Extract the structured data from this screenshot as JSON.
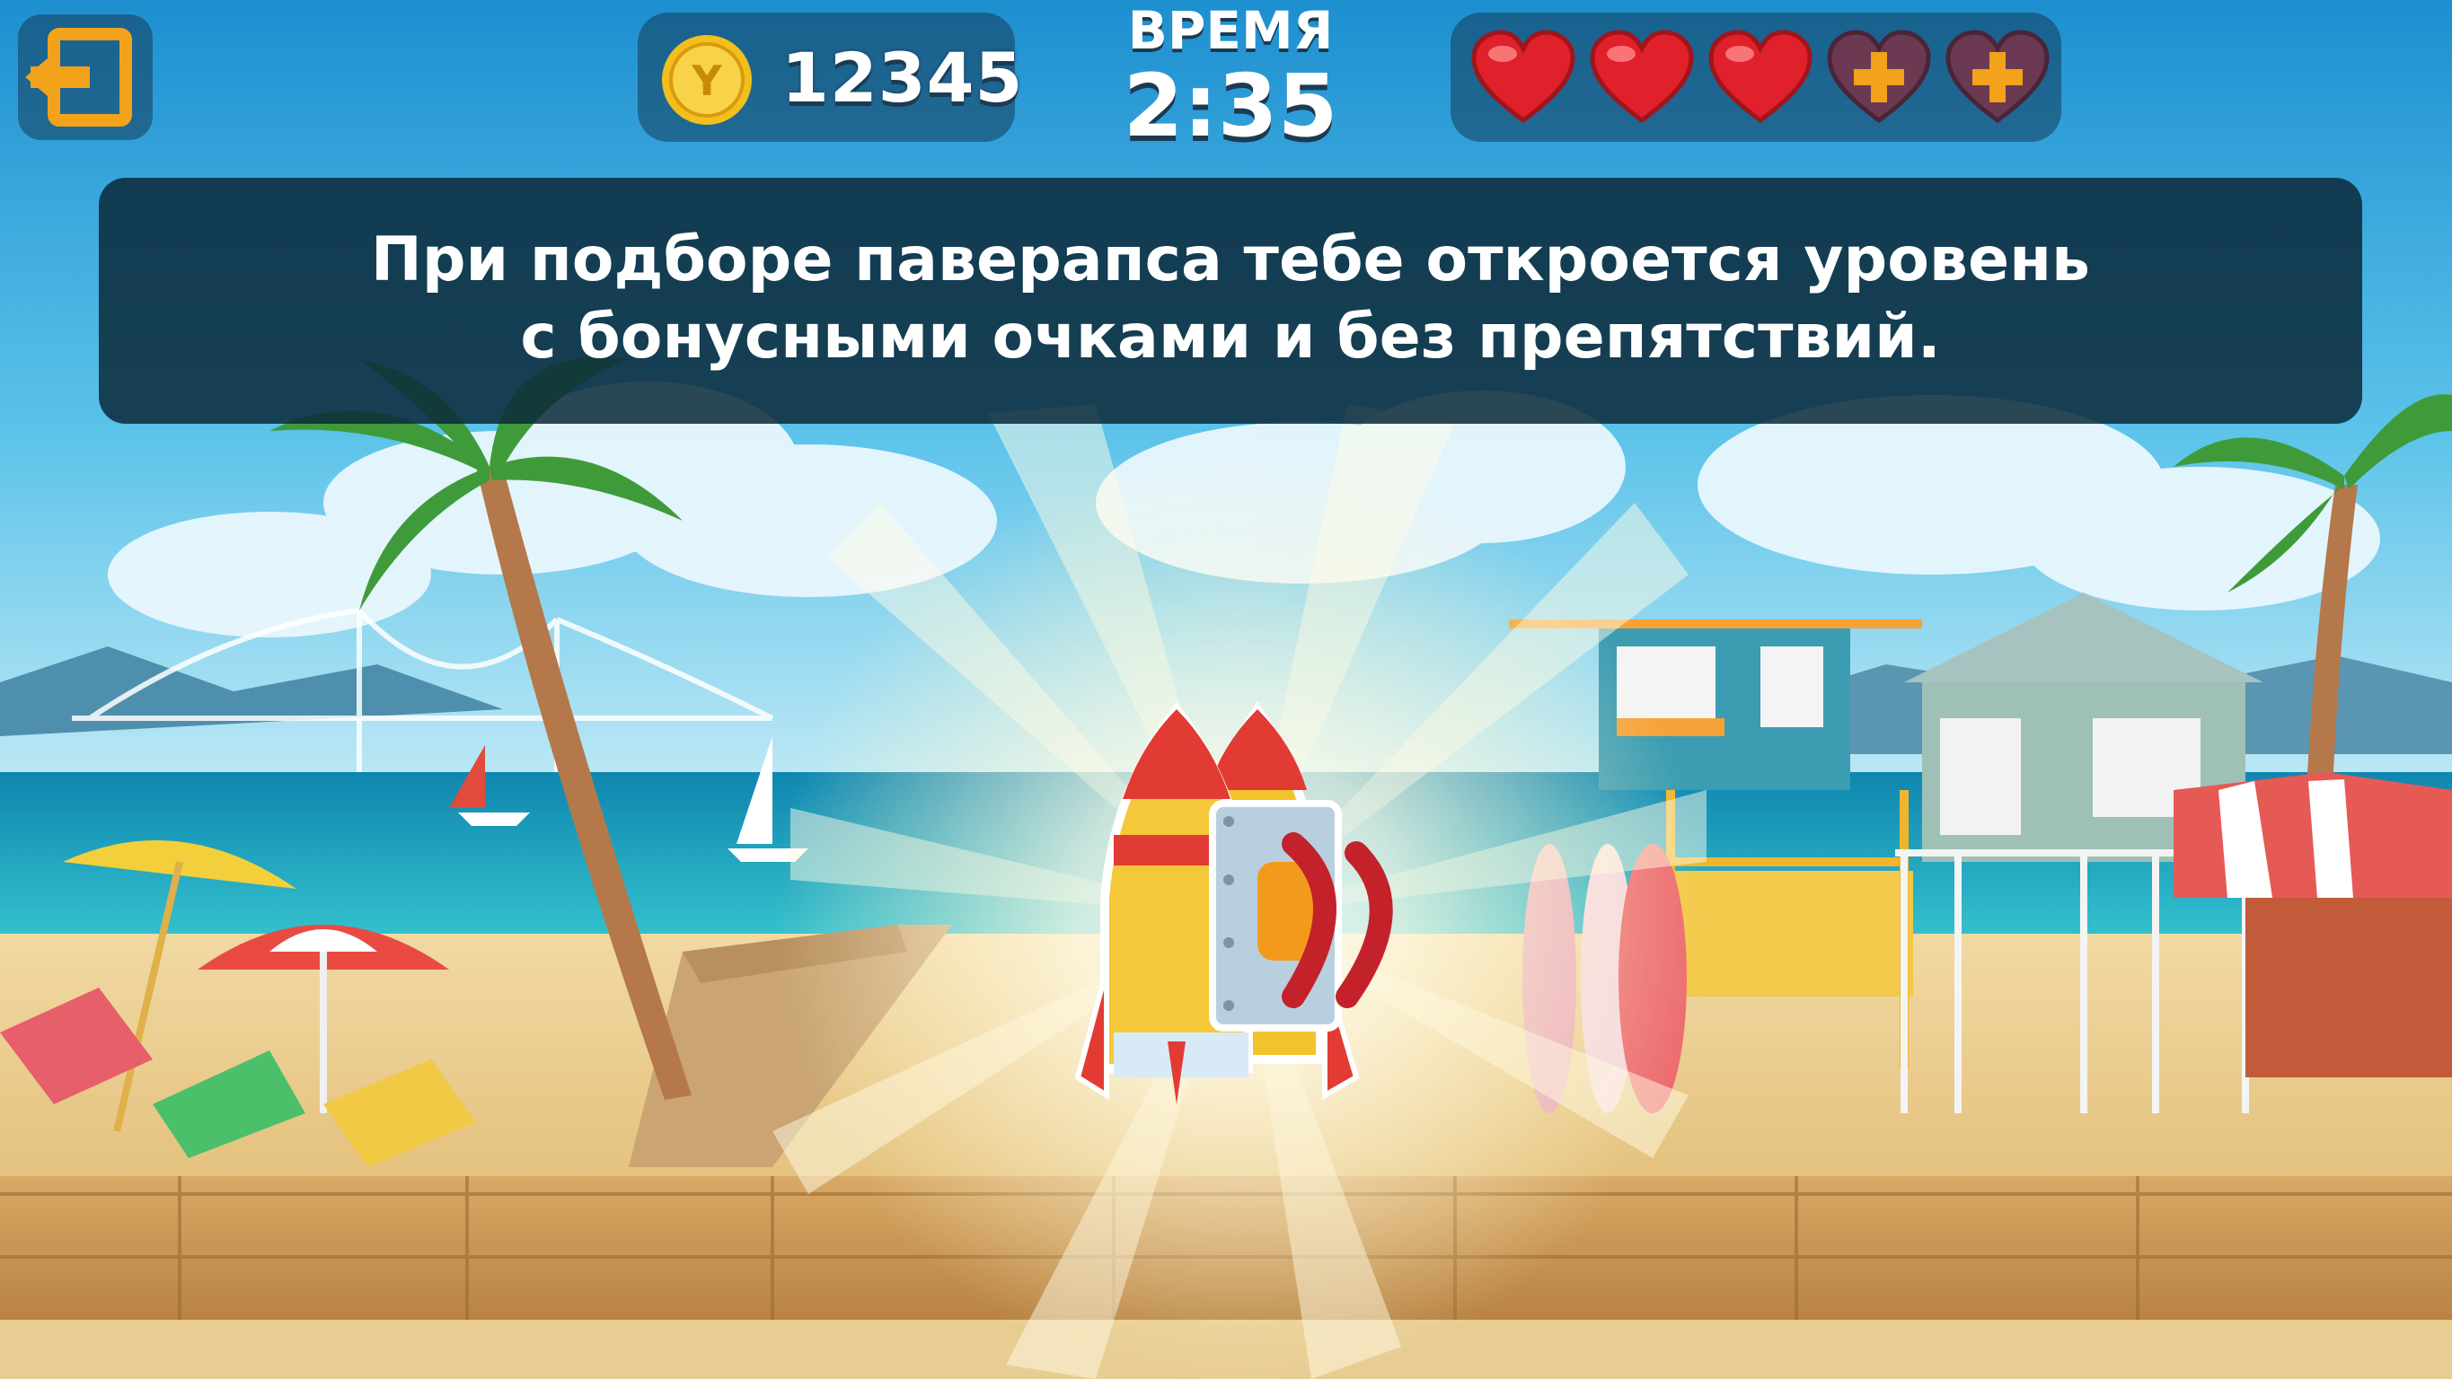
{
  "hud": {
    "coins": "12345",
    "coin_symbol": "Y",
    "timer_label": "ВРЕМЯ",
    "timer_value": "2:35",
    "hearts_filled": 3,
    "hearts_total": 5
  },
  "hint": {
    "line1": "При подборе паверапса тебе откроется уровень",
    "line2": "с бонусными очками и без препятствий."
  },
  "colors": {
    "accent_orange": "#f2a21b",
    "heart_red": "#e0202a",
    "panel": "#143c5a"
  },
  "icons": {
    "exit": "exit-door-arrow-icon",
    "coin": "coin-icon",
    "heart": "heart-icon",
    "heart_empty": "heart-plus-icon",
    "powerup": "jetpack-rocket-powerup"
  }
}
